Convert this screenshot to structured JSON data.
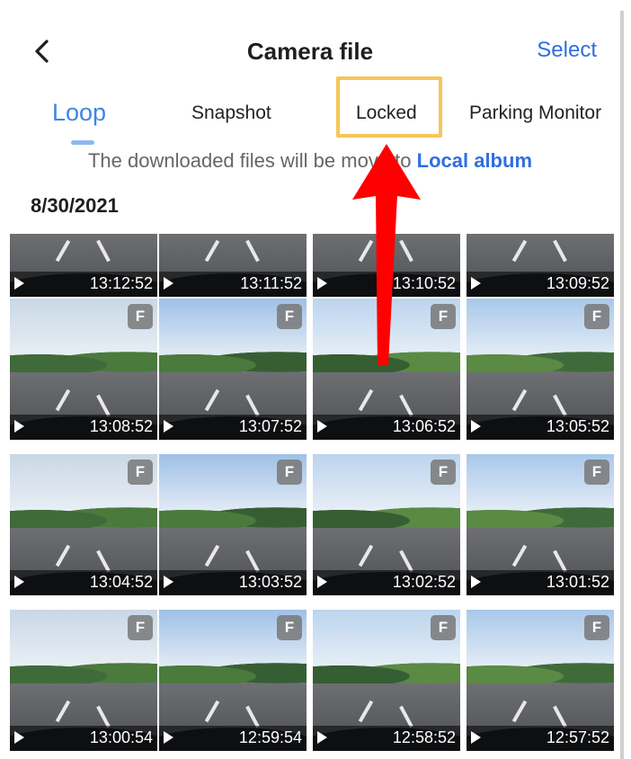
{
  "header": {
    "back_icon": "chevron-left-icon",
    "title": "Camera file",
    "select_label": "Select"
  },
  "tabs": [
    {
      "label": "Loop",
      "active": true
    },
    {
      "label": "Snapshot",
      "active": false
    },
    {
      "label": "Locked",
      "active": false
    },
    {
      "label": "Parking Monitor",
      "active": false
    }
  ],
  "notice": {
    "text": "The downloaded files will be move to ",
    "link": "Local album"
  },
  "date_group": "8/30/2021",
  "badge_label": "F",
  "videos": [
    {
      "time": "13:12:52"
    },
    {
      "time": "13:11:52"
    },
    {
      "time": "13:10:52"
    },
    {
      "time": "13:09:52"
    },
    {
      "time": "13:08:52"
    },
    {
      "time": "13:07:52"
    },
    {
      "time": "13:06:52"
    },
    {
      "time": "13:05:52"
    },
    {
      "time": "13:04:52"
    },
    {
      "time": "13:03:52"
    },
    {
      "time": "13:02:52"
    },
    {
      "time": "13:01:52"
    },
    {
      "time": "13:00:54"
    },
    {
      "time": "12:59:54"
    },
    {
      "time": "12:58:52"
    },
    {
      "time": "12:57:52"
    }
  ],
  "colors": {
    "accent": "#2f6fe0",
    "active_tab": "#3b86e6",
    "highlight_box": "#f5c75a",
    "arrow": "#ff0000"
  }
}
